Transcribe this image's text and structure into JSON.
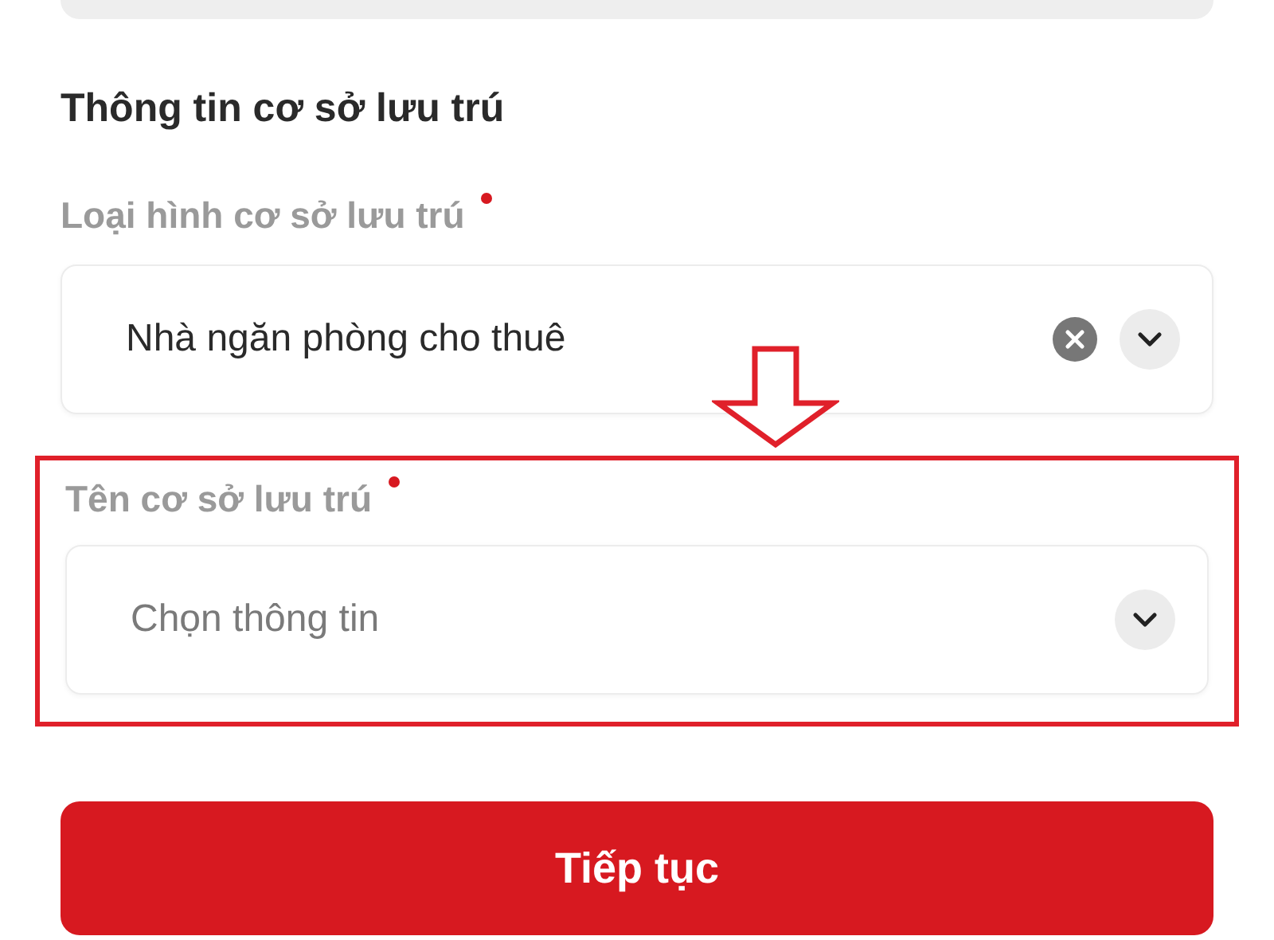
{
  "section_title": "Thông tin cơ sở lưu trú",
  "fields": [
    {
      "label": "Loại hình cơ sở lưu trú",
      "required": true,
      "value": "Nhà ngăn phòng cho thuê",
      "clearable": true,
      "highlighted": false
    },
    {
      "label": "Tên cơ sở lưu trú",
      "required": true,
      "placeholder": "Chọn thông tin",
      "clearable": false,
      "highlighted": true
    }
  ],
  "button": {
    "label": "Tiếp tục"
  }
}
